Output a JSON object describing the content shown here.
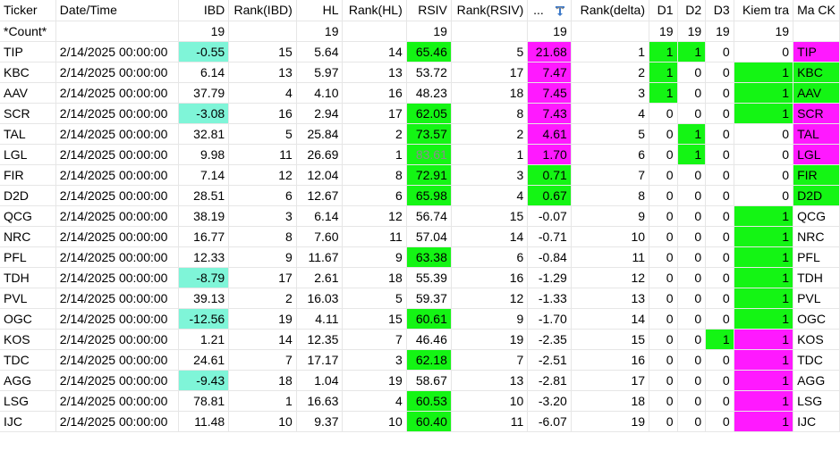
{
  "columns": {
    "ticker": "Ticker",
    "datetime": "Date/Time",
    "ibd": "IBD",
    "rank_ibd": "Rank(IBD)",
    "hl": "HL",
    "rank_hl": "Rank(HL)",
    "rsiv": "RSIV",
    "rank_rsiv": "Rank(RSIV)",
    "delta": "...",
    "rank_delta": "Rank(delta)",
    "d1": "D1",
    "d2": "D2",
    "d3": "D3",
    "kiem_tra": "Kiem tra",
    "ma_ck": "Ma CK"
  },
  "count_row": {
    "label": "*Count*",
    "ibd": "19",
    "hl": "19",
    "rsiv": "19",
    "delta": "19",
    "d1": "19",
    "d2": "19",
    "d3": "19",
    "kiem_tra": "19"
  },
  "colors": {
    "teal": "#7ff5d8",
    "green": "#14f514",
    "magenta": "#ff19ff",
    "gray_text": "#8c8c8c"
  },
  "rows": [
    {
      "ticker": "TIP",
      "datetime": "2/14/2025 00:00:00",
      "ibd": "-0.55",
      "rank_ibd": "15",
      "hl": "5.64",
      "rank_hl": "14",
      "rsiv": "65.46",
      "rank_rsiv": "5",
      "delta": "21.68",
      "rank_delta": "1",
      "d1": "1",
      "d2": "1",
      "d3": "0",
      "kiem_tra": "0",
      "ma_ck": "TIP",
      "ibd_c": "teal",
      "rsiv_c": "green",
      "delta_c": "magenta",
      "d1_c": "green",
      "d2_c": "green",
      "d3_c": "",
      "kt_c": "",
      "ma_c": "magenta"
    },
    {
      "ticker": "KBC",
      "datetime": "2/14/2025 00:00:00",
      "ibd": "6.14",
      "rank_ibd": "13",
      "hl": "5.97",
      "rank_hl": "13",
      "rsiv": "53.72",
      "rank_rsiv": "17",
      "delta": "7.47",
      "rank_delta": "2",
      "d1": "1",
      "d2": "0",
      "d3": "0",
      "kiem_tra": "1",
      "ma_ck": "KBC",
      "ibd_c": "",
      "rsiv_c": "",
      "delta_c": "magenta",
      "d1_c": "green",
      "d2_c": "",
      "d3_c": "",
      "kt_c": "green",
      "ma_c": "green"
    },
    {
      "ticker": "AAV",
      "datetime": "2/14/2025 00:00:00",
      "ibd": "37.79",
      "rank_ibd": "4",
      "hl": "4.10",
      "rank_hl": "16",
      "rsiv": "48.23",
      "rank_rsiv": "18",
      "delta": "7.45",
      "rank_delta": "3",
      "d1": "1",
      "d2": "0",
      "d3": "0",
      "kiem_tra": "1",
      "ma_ck": "AAV",
      "ibd_c": "",
      "rsiv_c": "",
      "delta_c": "magenta",
      "d1_c": "green",
      "d2_c": "",
      "d3_c": "",
      "kt_c": "green",
      "ma_c": "green"
    },
    {
      "ticker": "SCR",
      "datetime": "2/14/2025 00:00:00",
      "ibd": "-3.08",
      "rank_ibd": "16",
      "hl": "2.94",
      "rank_hl": "17",
      "rsiv": "62.05",
      "rank_rsiv": "8",
      "delta": "7.43",
      "rank_delta": "4",
      "d1": "0",
      "d2": "0",
      "d3": "0",
      "kiem_tra": "1",
      "ma_ck": "SCR",
      "ibd_c": "teal",
      "rsiv_c": "green",
      "delta_c": "magenta",
      "d1_c": "",
      "d2_c": "",
      "d3_c": "",
      "kt_c": "green",
      "ma_c": "magenta"
    },
    {
      "ticker": "TAL",
      "datetime": "2/14/2025 00:00:00",
      "ibd": "32.81",
      "rank_ibd": "5",
      "hl": "25.84",
      "rank_hl": "2",
      "rsiv": "73.57",
      "rank_rsiv": "2",
      "delta": "4.61",
      "rank_delta": "5",
      "d1": "0",
      "d2": "1",
      "d3": "0",
      "kiem_tra": "0",
      "ma_ck": "TAL",
      "ibd_c": "",
      "rsiv_c": "green",
      "delta_c": "magenta",
      "d1_c": "",
      "d2_c": "green",
      "d3_c": "",
      "kt_c": "",
      "ma_c": "magenta"
    },
    {
      "ticker": "LGL",
      "datetime": "2/14/2025 00:00:00",
      "ibd": "9.98",
      "rank_ibd": "11",
      "hl": "26.69",
      "rank_hl": "1",
      "rsiv": "83.61",
      "rank_rsiv": "1",
      "delta": "1.70",
      "rank_delta": "6",
      "d1": "0",
      "d2": "1",
      "d3": "0",
      "kiem_tra": "0",
      "ma_ck": "LGL",
      "ibd_c": "",
      "rsiv_c": "green gray-text",
      "delta_c": "magenta",
      "d1_c": "",
      "d2_c": "green",
      "d3_c": "",
      "kt_c": "",
      "ma_c": "magenta"
    },
    {
      "ticker": "FIR",
      "datetime": "2/14/2025 00:00:00",
      "ibd": "7.14",
      "rank_ibd": "12",
      "hl": "12.04",
      "rank_hl": "8",
      "rsiv": "72.91",
      "rank_rsiv": "3",
      "delta": "0.71",
      "rank_delta": "7",
      "d1": "0",
      "d2": "0",
      "d3": "0",
      "kiem_tra": "0",
      "ma_ck": "FIR",
      "ibd_c": "",
      "rsiv_c": "green",
      "delta_c": "green",
      "d1_c": "",
      "d2_c": "",
      "d3_c": "",
      "kt_c": "",
      "ma_c": "green"
    },
    {
      "ticker": "D2D",
      "datetime": "2/14/2025 00:00:00",
      "ibd": "28.51",
      "rank_ibd": "6",
      "hl": "12.67",
      "rank_hl": "6",
      "rsiv": "65.98",
      "rank_rsiv": "4",
      "delta": "0.67",
      "rank_delta": "8",
      "d1": "0",
      "d2": "0",
      "d3": "0",
      "kiem_tra": "0",
      "ma_ck": "D2D",
      "ibd_c": "",
      "rsiv_c": "green",
      "delta_c": "green",
      "d1_c": "",
      "d2_c": "",
      "d3_c": "",
      "kt_c": "",
      "ma_c": "green"
    },
    {
      "ticker": "QCG",
      "datetime": "2/14/2025 00:00:00",
      "ibd": "38.19",
      "rank_ibd": "3",
      "hl": "6.14",
      "rank_hl": "12",
      "rsiv": "56.74",
      "rank_rsiv": "15",
      "delta": "-0.07",
      "rank_delta": "9",
      "d1": "0",
      "d2": "0",
      "d3": "0",
      "kiem_tra": "1",
      "ma_ck": "QCG",
      "ibd_c": "",
      "rsiv_c": "",
      "delta_c": "",
      "d1_c": "",
      "d2_c": "",
      "d3_c": "",
      "kt_c": "green",
      "ma_c": ""
    },
    {
      "ticker": "NRC",
      "datetime": "2/14/2025 00:00:00",
      "ibd": "16.77",
      "rank_ibd": "8",
      "hl": "7.60",
      "rank_hl": "11",
      "rsiv": "57.04",
      "rank_rsiv": "14",
      "delta": "-0.71",
      "rank_delta": "10",
      "d1": "0",
      "d2": "0",
      "d3": "0",
      "kiem_tra": "1",
      "ma_ck": "NRC",
      "ibd_c": "",
      "rsiv_c": "",
      "delta_c": "",
      "d1_c": "",
      "d2_c": "",
      "d3_c": "",
      "kt_c": "green",
      "ma_c": ""
    },
    {
      "ticker": "PFL",
      "datetime": "2/14/2025 00:00:00",
      "ibd": "12.33",
      "rank_ibd": "9",
      "hl": "11.67",
      "rank_hl": "9",
      "rsiv": "63.38",
      "rank_rsiv": "6",
      "delta": "-0.84",
      "rank_delta": "11",
      "d1": "0",
      "d2": "0",
      "d3": "0",
      "kiem_tra": "1",
      "ma_ck": "PFL",
      "ibd_c": "",
      "rsiv_c": "green",
      "delta_c": "",
      "d1_c": "",
      "d2_c": "",
      "d3_c": "",
      "kt_c": "green",
      "ma_c": ""
    },
    {
      "ticker": "TDH",
      "datetime": "2/14/2025 00:00:00",
      "ibd": "-8.79",
      "rank_ibd": "17",
      "hl": "2.61",
      "rank_hl": "18",
      "rsiv": "55.39",
      "rank_rsiv": "16",
      "delta": "-1.29",
      "rank_delta": "12",
      "d1": "0",
      "d2": "0",
      "d3": "0",
      "kiem_tra": "1",
      "ma_ck": "TDH",
      "ibd_c": "teal",
      "rsiv_c": "",
      "delta_c": "",
      "d1_c": "",
      "d2_c": "",
      "d3_c": "",
      "kt_c": "green",
      "ma_c": ""
    },
    {
      "ticker": "PVL",
      "datetime": "2/14/2025 00:00:00",
      "ibd": "39.13",
      "rank_ibd": "2",
      "hl": "16.03",
      "rank_hl": "5",
      "rsiv": "59.37",
      "rank_rsiv": "12",
      "delta": "-1.33",
      "rank_delta": "13",
      "d1": "0",
      "d2": "0",
      "d3": "0",
      "kiem_tra": "1",
      "ma_ck": "PVL",
      "ibd_c": "",
      "rsiv_c": "",
      "delta_c": "",
      "d1_c": "",
      "d2_c": "",
      "d3_c": "",
      "kt_c": "green",
      "ma_c": ""
    },
    {
      "ticker": "OGC",
      "datetime": "2/14/2025 00:00:00",
      "ibd": "-12.56",
      "rank_ibd": "19",
      "hl": "4.11",
      "rank_hl": "15",
      "rsiv": "60.61",
      "rank_rsiv": "9",
      "delta": "-1.70",
      "rank_delta": "14",
      "d1": "0",
      "d2": "0",
      "d3": "0",
      "kiem_tra": "1",
      "ma_ck": "OGC",
      "ibd_c": "teal",
      "rsiv_c": "green",
      "delta_c": "",
      "d1_c": "",
      "d2_c": "",
      "d3_c": "",
      "kt_c": "green",
      "ma_c": ""
    },
    {
      "ticker": "KOS",
      "datetime": "2/14/2025 00:00:00",
      "ibd": "1.21",
      "rank_ibd": "14",
      "hl": "12.35",
      "rank_hl": "7",
      "rsiv": "46.46",
      "rank_rsiv": "19",
      "delta": "-2.35",
      "rank_delta": "15",
      "d1": "0",
      "d2": "0",
      "d3": "1",
      "kiem_tra": "1",
      "ma_ck": "KOS",
      "ibd_c": "",
      "rsiv_c": "",
      "delta_c": "",
      "d1_c": "",
      "d2_c": "",
      "d3_c": "green",
      "kt_c": "magenta",
      "ma_c": ""
    },
    {
      "ticker": "TDC",
      "datetime": "2/14/2025 00:00:00",
      "ibd": "24.61",
      "rank_ibd": "7",
      "hl": "17.17",
      "rank_hl": "3",
      "rsiv": "62.18",
      "rank_rsiv": "7",
      "delta": "-2.51",
      "rank_delta": "16",
      "d1": "0",
      "d2": "0",
      "d3": "0",
      "kiem_tra": "1",
      "ma_ck": "TDC",
      "ibd_c": "",
      "rsiv_c": "green",
      "delta_c": "",
      "d1_c": "",
      "d2_c": "",
      "d3_c": "",
      "kt_c": "magenta",
      "ma_c": ""
    },
    {
      "ticker": "AGG",
      "datetime": "2/14/2025 00:00:00",
      "ibd": "-9.43",
      "rank_ibd": "18",
      "hl": "1.04",
      "rank_hl": "19",
      "rsiv": "58.67",
      "rank_rsiv": "13",
      "delta": "-2.81",
      "rank_delta": "17",
      "d1": "0",
      "d2": "0",
      "d3": "0",
      "kiem_tra": "1",
      "ma_ck": "AGG",
      "ibd_c": "teal",
      "rsiv_c": "",
      "delta_c": "",
      "d1_c": "",
      "d2_c": "",
      "d3_c": "",
      "kt_c": "magenta",
      "ma_c": ""
    },
    {
      "ticker": "LSG",
      "datetime": "2/14/2025 00:00:00",
      "ibd": "78.81",
      "rank_ibd": "1",
      "hl": "16.63",
      "rank_hl": "4",
      "rsiv": "60.53",
      "rank_rsiv": "10",
      "delta": "-3.20",
      "rank_delta": "18",
      "d1": "0",
      "d2": "0",
      "d3": "0",
      "kiem_tra": "1",
      "ma_ck": "LSG",
      "ibd_c": "",
      "rsiv_c": "green",
      "delta_c": "",
      "d1_c": "",
      "d2_c": "",
      "d3_c": "",
      "kt_c": "magenta",
      "ma_c": ""
    },
    {
      "ticker": "IJC",
      "datetime": "2/14/2025 00:00:00",
      "ibd": "11.48",
      "rank_ibd": "10",
      "hl": "9.37",
      "rank_hl": "10",
      "rsiv": "60.40",
      "rank_rsiv": "11",
      "delta": "-6.07",
      "rank_delta": "19",
      "d1": "0",
      "d2": "0",
      "d3": "0",
      "kiem_tra": "1",
      "ma_ck": "IJC",
      "ibd_c": "",
      "rsiv_c": "green",
      "delta_c": "",
      "d1_c": "",
      "d2_c": "",
      "d3_c": "",
      "kt_c": "magenta",
      "ma_c": ""
    }
  ]
}
